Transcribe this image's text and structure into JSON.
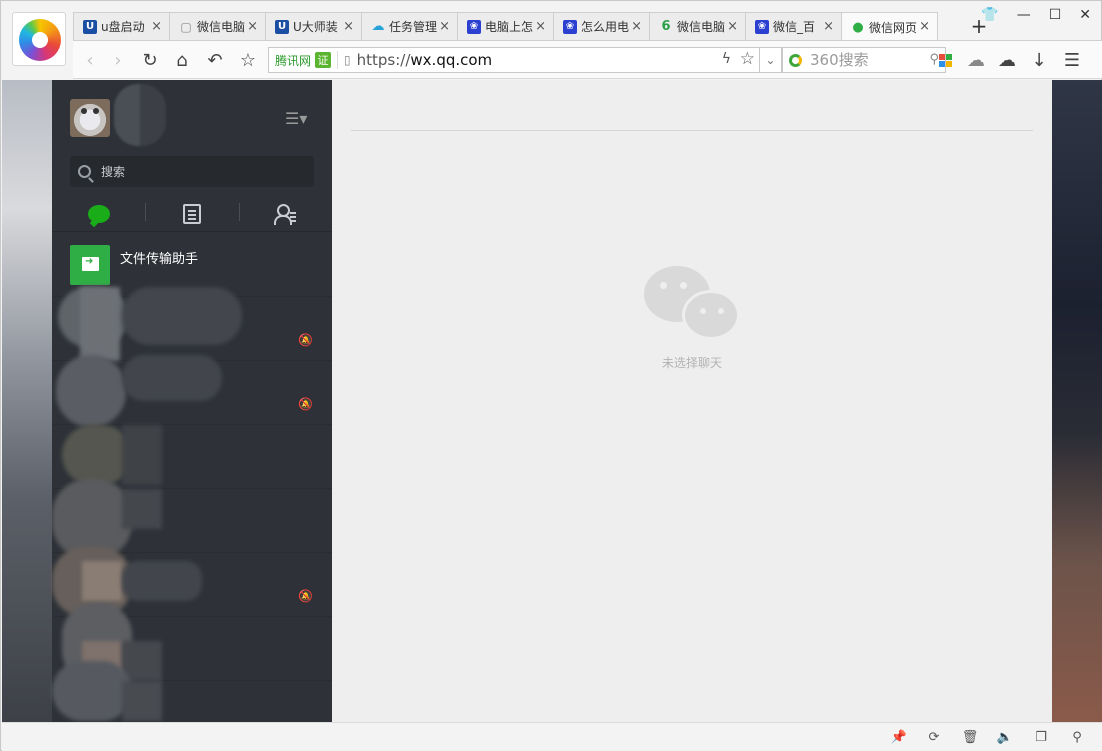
{
  "browser": {
    "tabs": [
      {
        "label": "u盘启动",
        "icon": "U",
        "icon_color": "#1b4fa3"
      },
      {
        "label": "微信电脑",
        "icon": "▢",
        "icon_color": "#8a8a8a"
      },
      {
        "label": "U大师装",
        "icon": "U",
        "icon_color": "#1b4fa3"
      },
      {
        "label": "任务管理",
        "icon": "☁",
        "icon_color": "#27a2d9"
      },
      {
        "label": "电脑上怎",
        "icon": "❀",
        "icon_color": "#2b3fd1"
      },
      {
        "label": "怎么用电",
        "icon": "❀",
        "icon_color": "#2b3fd1"
      },
      {
        "label": "微信电脑",
        "icon": "6",
        "icon_color": "#2aa148"
      },
      {
        "label": "微信_百",
        "icon": "❀",
        "icon_color": "#2b3fd1"
      },
      {
        "label": "微信网页",
        "icon": "●",
        "icon_color": "#2fae45",
        "active": true
      }
    ],
    "new_tab": "+",
    "address": {
      "site_name": "腾讯网",
      "cert_badge": "证",
      "url_scheme": "https://",
      "url_host": "wx.qq.com"
    },
    "search": {
      "placeholder": "360搜索"
    }
  },
  "wechat": {
    "search_placeholder": "搜索",
    "chats": [
      {
        "name": "文件传输助手"
      }
    ],
    "empty_state": "未选择聊天"
  },
  "colors": {
    "wechat_green": "#1aad19",
    "sidebar_bg": "#2e3238",
    "chat_bg": "#eeeeee"
  }
}
